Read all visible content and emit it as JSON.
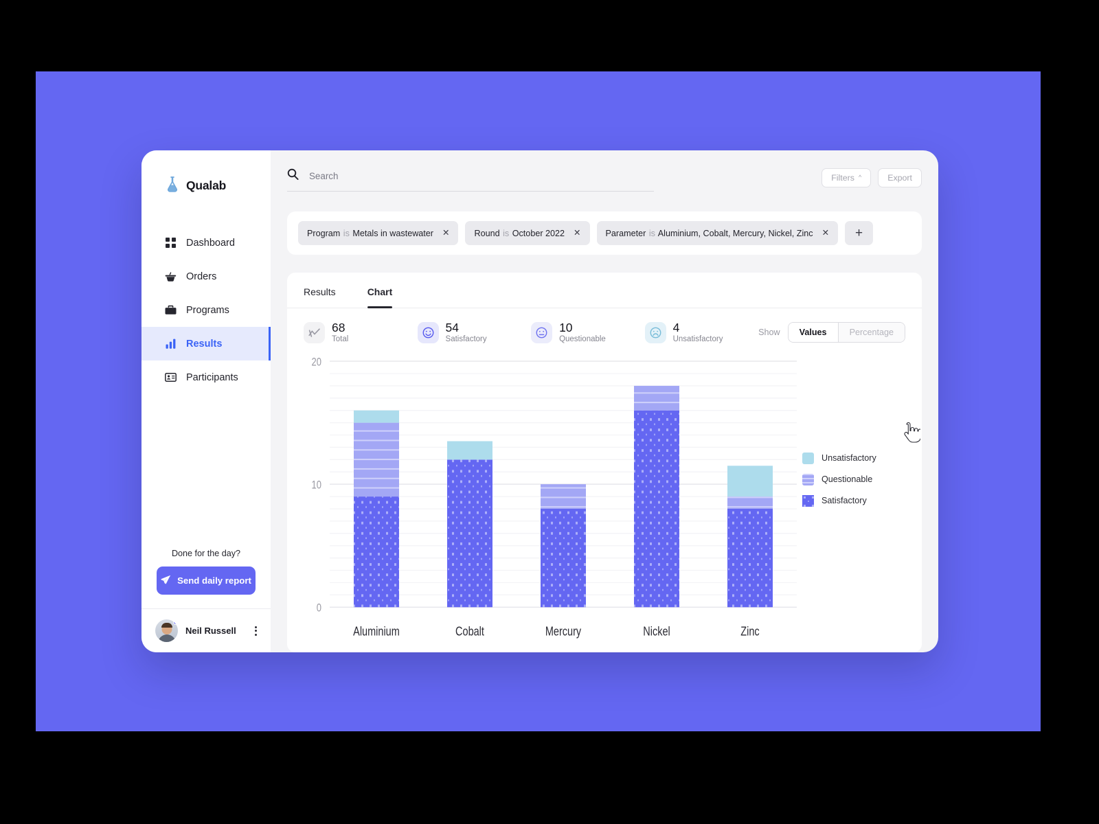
{
  "brand": {
    "name": "Qualab",
    "logo_icon": "flask-icon"
  },
  "sidebar": {
    "items": [
      {
        "label": "Dashboard",
        "icon": "grid-icon",
        "active": false
      },
      {
        "label": "Orders",
        "icon": "basket-icon",
        "active": false
      },
      {
        "label": "Programs",
        "icon": "briefcase-icon",
        "active": false
      },
      {
        "label": "Results",
        "icon": "bar-chart-icon",
        "active": true
      },
      {
        "label": "Participants",
        "icon": "id-card-icon",
        "active": false
      }
    ],
    "cta": {
      "label": "Done for the day?",
      "button": "Send daily report",
      "icon": "send-icon"
    },
    "user": {
      "name": "Neil Russell",
      "menu_icon": "kebab-menu-icon",
      "status": "online"
    }
  },
  "search": {
    "placeholder": "Search",
    "value": "",
    "icon": "search-icon"
  },
  "top_actions": {
    "filters": "Filters",
    "filters_caret": "^",
    "export": "Export"
  },
  "filters": {
    "chips": [
      {
        "key": "Program",
        "op": "is",
        "value": "Metals in wastewater"
      },
      {
        "key": "Round",
        "op": "is",
        "value": "October 2022"
      },
      {
        "key": "Parameter",
        "op": "is",
        "value": "Aluminium, Cobalt, Mercury, Nickel, Zinc"
      }
    ],
    "add_label": "+",
    "remove_icon": "close-icon"
  },
  "tabs": [
    {
      "label": "Results",
      "active": false
    },
    {
      "label": "Chart",
      "active": true
    }
  ],
  "stats": [
    {
      "value": "68",
      "label": "Total",
      "icon": "line-chart-icon",
      "style": "total"
    },
    {
      "value": "54",
      "label": "Satisfactory",
      "icon": "smiley-happy-icon",
      "style": "sat"
    },
    {
      "value": "10",
      "label": "Questionable",
      "icon": "smiley-neutral-icon",
      "style": "que"
    },
    {
      "value": "4",
      "label": "Unsatisfactory",
      "icon": "smiley-sad-icon",
      "style": "uns"
    }
  ],
  "show_toggle": {
    "label": "Show",
    "options": [
      "Values",
      "Percentage"
    ],
    "selected": "Values"
  },
  "colors": {
    "accent": "#6467f2",
    "satisfactory": "#6467f2",
    "questionable": "#a3a7f5",
    "unsatisfactory": "#addcec",
    "canvas": "#6467f2",
    "sidebar_active_bg": "#e6eafd",
    "sidebar_active_fg": "#3b63f6"
  },
  "chart_data": {
    "type": "bar",
    "stacked": true,
    "title": "",
    "xlabel": "",
    "ylabel": "",
    "categories": [
      "Aluminium",
      "Cobalt",
      "Mercury",
      "Nickel",
      "Zinc"
    ],
    "series": [
      {
        "name": "Satisfactory",
        "values": [
          9,
          12,
          8,
          16,
          8
        ]
      },
      {
        "name": "Questionable",
        "values": [
          6,
          0,
          2,
          2,
          1
        ]
      },
      {
        "name": "Unsatisfactory",
        "values": [
          1,
          1.5,
          0,
          0,
          2.5
        ]
      }
    ],
    "totals": [
      16,
      13.5,
      10,
      18,
      11.5
    ],
    "ylim": [
      0,
      20
    ],
    "yticks": [
      0,
      10,
      20
    ],
    "ytick_labels": [
      "0",
      "10",
      "20"
    ],
    "gridline_step": 1,
    "grid": true,
    "legend": [
      "Unsatisfactory",
      "Questionable",
      "Satisfactory"
    ],
    "legend_position": "right"
  }
}
